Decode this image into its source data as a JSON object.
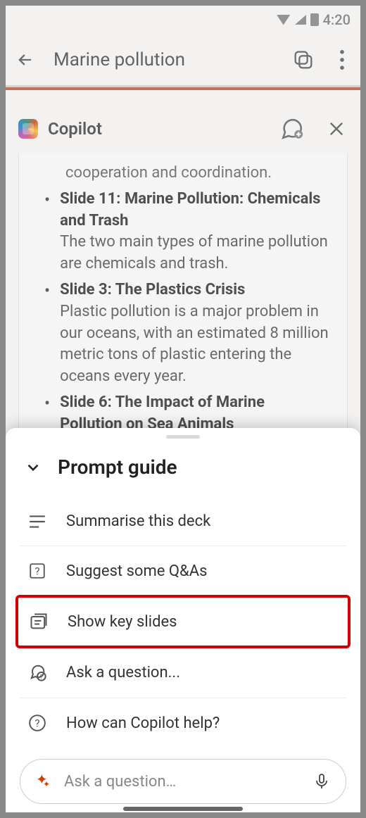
{
  "statusbar": {
    "time": "4:20"
  },
  "header": {
    "title": "Marine pollution"
  },
  "copilot": {
    "title": "Copilot",
    "truncated_line": "cooperation and coordination.",
    "slides": [
      {
        "title": "Slide 11: Marine Pollution: Chemicals and Trash",
        "desc": "The two main types of marine pollution are chemicals and trash."
      },
      {
        "title": "Slide 3: The Plastics Crisis",
        "desc": "Plastic pollution is a major problem in our oceans, with an estimated 8 million metric tons of plastic entering the oceans every year."
      },
      {
        "title": "Slide 6: The Impact of Marine Pollution on Sea Animals",
        "desc": ""
      }
    ]
  },
  "sheet": {
    "title": "Prompt guide",
    "options": {
      "summarise": "Summarise this deck",
      "qas": "Suggest some Q&As",
      "keyslides": "Show key slides",
      "ask": "Ask a question...",
      "help": "How can Copilot help?"
    },
    "input_placeholder": "Ask a question…"
  }
}
